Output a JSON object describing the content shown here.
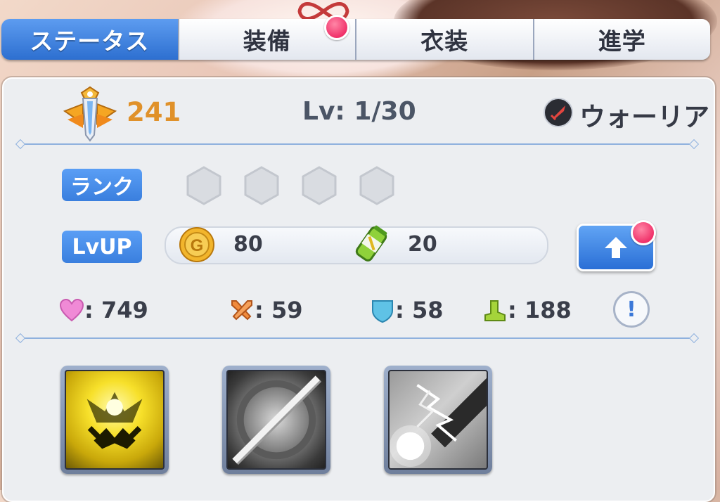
{
  "tabs": [
    {
      "label": "ステータス",
      "active": true
    },
    {
      "label": "装備",
      "active": false,
      "notification": true
    },
    {
      "label": "衣装",
      "active": false
    },
    {
      "label": "進学",
      "active": false
    }
  ],
  "header": {
    "power": "241",
    "level": "Lv: 1/30",
    "role": "ウォーリア",
    "power_icon": "sword-crest-icon",
    "role_icon": "sword-role-icon"
  },
  "rank": {
    "label": "ランク",
    "slots": 4
  },
  "lvup": {
    "label": "LvUP",
    "coin_cost": "80",
    "item_cost": "20",
    "coin_icon": "gold-coin-icon",
    "item_icon": "energy-can-icon",
    "button_icon": "up-arrow-icon"
  },
  "stats": [
    {
      "icon": "heart-icon",
      "value": ": 749"
    },
    {
      "icon": "crossed-swords-icon",
      "value": ": 59"
    },
    {
      "icon": "shield-icon",
      "value": ": 58"
    },
    {
      "icon": "boot-icon",
      "value": ": 188"
    }
  ],
  "info_button": "!",
  "skills": [
    {
      "name": "skill-golden-crest",
      "unlocked": true
    },
    {
      "name": "skill-slash",
      "unlocked": false
    },
    {
      "name": "skill-lightning",
      "unlocked": false
    }
  ],
  "colors": {
    "accent_blue": "#3a7fde",
    "power_gold": "#e0912a",
    "notification_pink": "#f0326a"
  }
}
